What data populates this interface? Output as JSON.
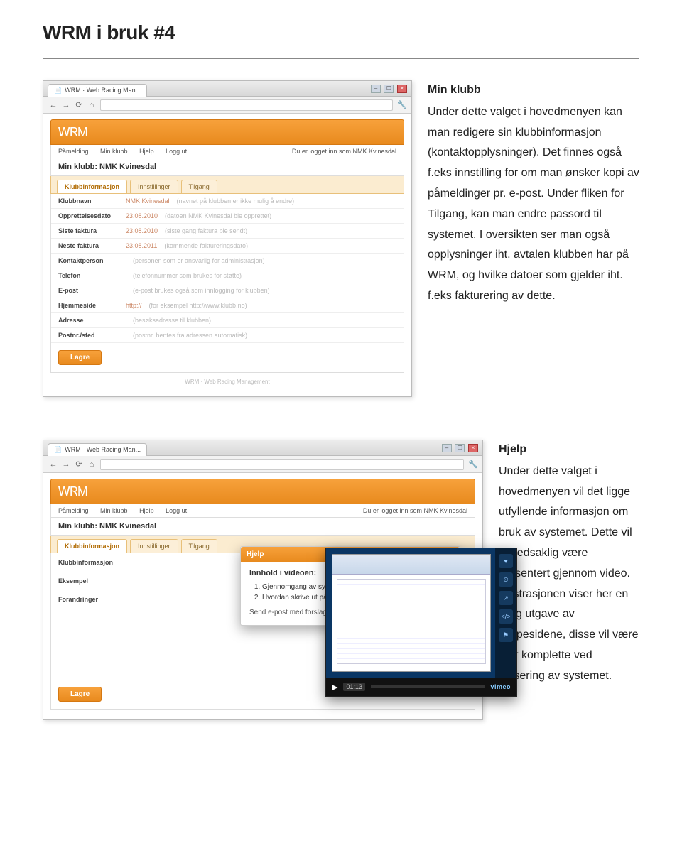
{
  "page": {
    "title": "WRM i bruk #4"
  },
  "browser": {
    "tab_title": "WRM · Web Racing Man...",
    "win_min": "–",
    "win_max": "☐",
    "win_close": "×",
    "nav_back": "←",
    "nav_fwd": "→",
    "nav_reload": "⟳",
    "nav_home": "⌂",
    "tools": "🔧"
  },
  "app": {
    "logo": "ᎳᏒΜ",
    "menu": {
      "item1": "Påmelding",
      "item2": "Min klubb",
      "item3": "Hjelp",
      "item4": "Logg ut"
    },
    "logged_in_as": "Du er logget inn som NMK Kvinesdal",
    "breadcrumb": "Min klubb: NMK Kvinesdal",
    "tabs": {
      "t1": "Klubbinformasjon",
      "t2": "Innstillinger",
      "t3": "Tilgang"
    },
    "save": "Lagre",
    "footer": "WRM · Web Racing Management"
  },
  "form": {
    "rows": [
      {
        "label": "Klubbnavn",
        "value": "NMK Kvinesdal",
        "hint": "(navnet på klubben er ikke mulig å endre)"
      },
      {
        "label": "Opprettelsesdato",
        "value": "23.08.2010",
        "hint": "(datoen NMK Kvinesdal ble opprettet)"
      },
      {
        "label": "Siste faktura",
        "value": "23.08.2010",
        "hint": "(siste gang faktura ble sendt)"
      },
      {
        "label": "Neste faktura",
        "value": "23.08.2011",
        "hint": "(kommende faktureringsdato)"
      },
      {
        "label": "Kontaktperson",
        "value": "",
        "hint": "(personen som er ansvarlig for administrasjon)"
      },
      {
        "label": "Telefon",
        "value": "",
        "hint": "(telefonnummer som brukes for støtte)"
      },
      {
        "label": "E-post",
        "value": "",
        "hint": "(e-post brukes også som innlogging for klubben)"
      },
      {
        "label": "Hjemmeside",
        "value": "http://",
        "hint": "(for eksempel http://www.klubb.no)"
      },
      {
        "label": "Adresse",
        "value": "",
        "hint": "(besøksadresse til klubben)"
      },
      {
        "label": "Postnr./sted",
        "value": "",
        "hint": "(postnr. hentes fra adressen automatisk)"
      }
    ]
  },
  "section1": {
    "heading": "Min klubb",
    "body": "Under dette valget i hovedmenyen kan man redigere sin klubbinformasjon (kontaktopplysninger). Det finnes også f.eks innstilling for om man ønsker kopi av påmeldinger pr. e-post. Under fliken for Tilgang, kan man endre passord til systemet. I oversikten ser man også opplysninger iht. avtalen klubben har på WRM, og hvilke datoer som gjelder iht. f.eks fakturering av dette."
  },
  "section2": {
    "heading": "Hjelp",
    "body": "Under dette valget i hovedmenyen vil det ligge utfyllende informasjon om bruk av systemet. Dette vil hovedsaklig være presentert gjennom video. Illustrasjonen viser her en tidlig utgave av hjelpesidene, disse vil være mer komplette ved lansering av systemet."
  },
  "help_shot": {
    "side": {
      "r1": "Klubbinformasjon",
      "r2": "Eksempel",
      "r3": "Forandringer"
    },
    "modal_title": "Hjelp",
    "modal_close": "×",
    "modal_heading": "Innhold i videoen:",
    "modal_li1": "Gjennomgang av systemet",
    "modal_li2": "Hvordan skrive ut påmeldingskort: pdf.",
    "modal_foot": "Send e-post med forslag til forbedringer.",
    "player": {
      "play": "▶",
      "time": "01:13",
      "like": "♥",
      "later": "⏲",
      "share": "↗",
      "embed": "</>",
      "flag": "⚑",
      "brand": "vimeo"
    }
  }
}
